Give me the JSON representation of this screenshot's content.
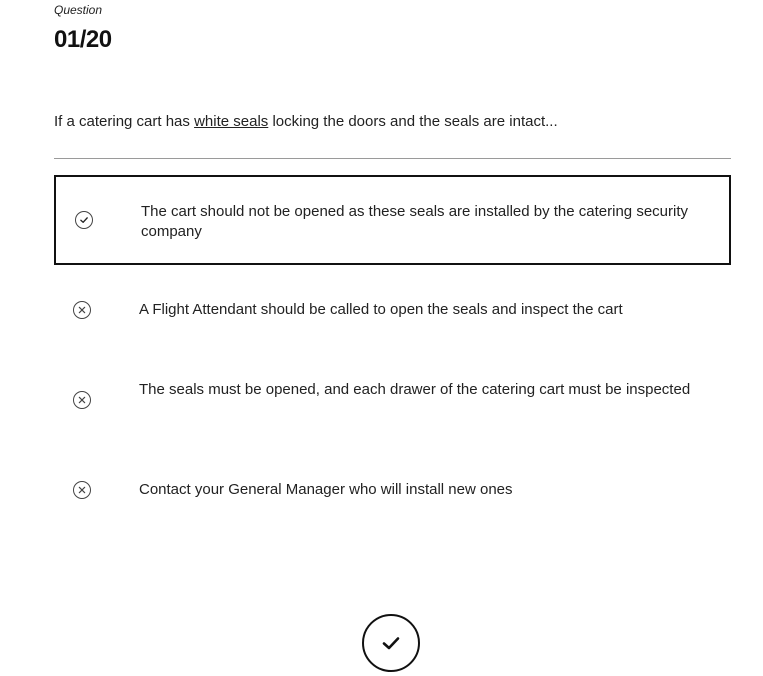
{
  "header": {
    "label": "Question",
    "number": "01/20"
  },
  "question": {
    "prefix": "If a catering cart has ",
    "underlined": "white seals",
    "suffix": " locking the doors and the seals are intact..."
  },
  "options": [
    {
      "text": "The cart should not be opened as these seals are installed by the catering security company",
      "icon": "check-circle-icon",
      "selected": true
    },
    {
      "text": "A Flight Attendant should be called to open the seals and inspect the cart",
      "icon": "x-circle-icon",
      "selected": false
    },
    {
      "text": "The seals must be opened, and each drawer of the catering cart must be inspected",
      "icon": "x-circle-icon",
      "selected": false
    },
    {
      "text": "Contact your General Manager who will install new ones",
      "icon": "x-circle-icon",
      "selected": false
    }
  ],
  "submit": {
    "icon": "checkmark-icon"
  }
}
